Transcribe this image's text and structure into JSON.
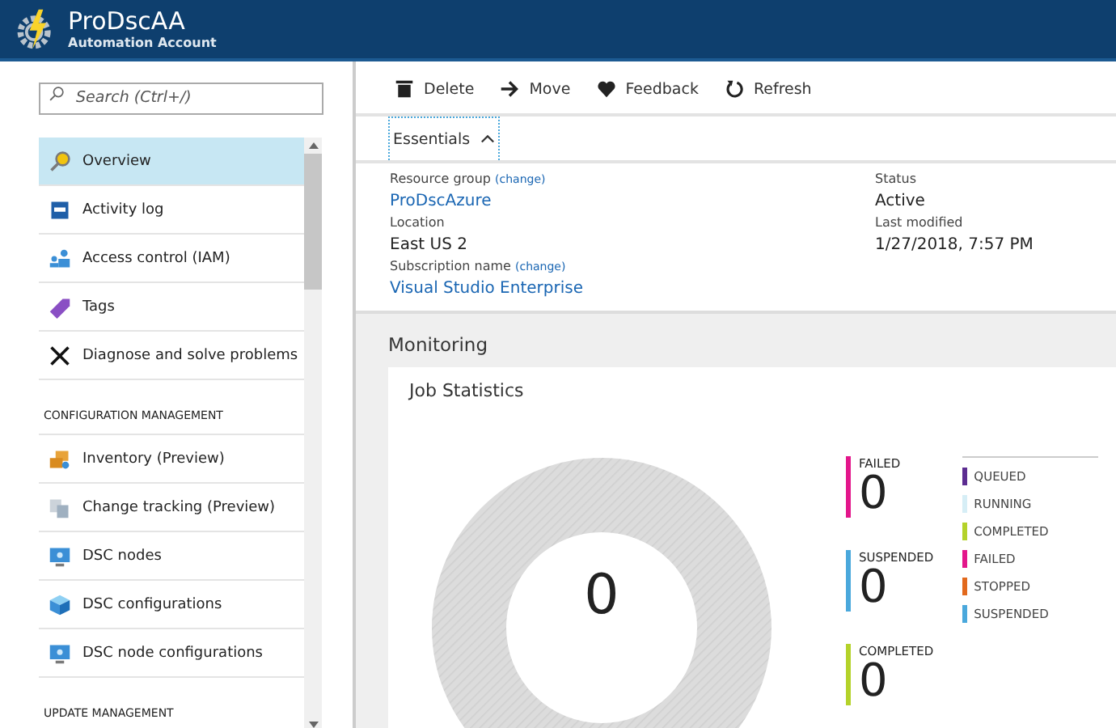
{
  "header": {
    "title": "ProDscAA",
    "subtitle": "Automation Account"
  },
  "sidebar": {
    "search": {
      "placeholder": "Search (Ctrl+/)"
    },
    "items": [
      {
        "kind": "item",
        "label": "Overview",
        "selected": true
      },
      {
        "kind": "item",
        "label": "Activity log",
        "selected": false
      },
      {
        "kind": "item",
        "label": "Access control (IAM)",
        "selected": false
      },
      {
        "kind": "item",
        "label": "Tags",
        "selected": false
      },
      {
        "kind": "item",
        "label": "Diagnose and solve problems",
        "selected": false
      },
      {
        "kind": "section",
        "label": "CONFIGURATION MANAGEMENT"
      },
      {
        "kind": "item",
        "label": "Inventory (Preview)",
        "selected": false
      },
      {
        "kind": "item",
        "label": "Change tracking (Preview)",
        "selected": false
      },
      {
        "kind": "item",
        "label": "DSC nodes",
        "selected": false
      },
      {
        "kind": "item",
        "label": "DSC configurations",
        "selected": false
      },
      {
        "kind": "item",
        "label": "DSC node configurations",
        "selected": false
      },
      {
        "kind": "section",
        "label": "UPDATE MANAGEMENT"
      }
    ]
  },
  "toolbar": [
    {
      "label": "Delete"
    },
    {
      "label": "Move"
    },
    {
      "label": "Feedback"
    },
    {
      "label": "Refresh"
    }
  ],
  "essentials": {
    "label": "Essentials",
    "expanded": true,
    "left": [
      {
        "label": "Resource group",
        "action": "(change)",
        "value": "ProDscAzure",
        "kind": "link"
      },
      {
        "label": "Location",
        "value": "East US 2",
        "kind": "text"
      },
      {
        "label": "Subscription name",
        "action": "(change)",
        "value": "Visual Studio Enterprise",
        "kind": "link"
      }
    ],
    "right": [
      {
        "label": "Status",
        "value": "Active"
      },
      {
        "label": "Last modified",
        "value": "1/27/2018, 7:57 PM"
      }
    ]
  },
  "monitoring": {
    "title": "Monitoring",
    "card_title": "Job Statistics",
    "total": "0",
    "stats": [
      {
        "label": "FAILED",
        "value": "0",
        "color": "#e3168b"
      },
      {
        "label": "SUSPENDED",
        "value": "0",
        "color": "#4aa8dc"
      },
      {
        "label": "COMPLETED",
        "value": "0",
        "color": "#b4d22a"
      }
    ],
    "legend": [
      {
        "label": "QUEUED",
        "color": "#5c2d91"
      },
      {
        "label": "RUNNING",
        "color": "#d6eef6"
      },
      {
        "label": "COMPLETED",
        "color": "#b4d22a"
      },
      {
        "label": "FAILED",
        "color": "#e3168b"
      },
      {
        "label": "STOPPED",
        "color": "#e2691d"
      },
      {
        "label": "SUSPENDED",
        "color": "#4aa8dc"
      }
    ]
  }
}
